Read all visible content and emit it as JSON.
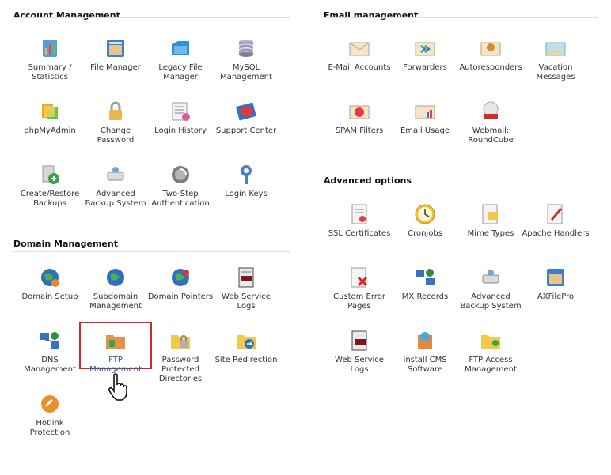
{
  "sections": {
    "account": {
      "title": "Account Management",
      "items": [
        {
          "label": "Summary / Statistics",
          "icon": "statistics-icon"
        },
        {
          "label": "File Manager",
          "icon": "file-manager-icon"
        },
        {
          "label": "Legacy File Manager",
          "icon": "legacy-file-manager-icon"
        },
        {
          "label": "MySQL Management",
          "icon": "database-icon"
        },
        {
          "label": "phpMyAdmin",
          "icon": "phpmyadmin-icon"
        },
        {
          "label": "Change Password",
          "icon": "padlock-icon"
        },
        {
          "label": "Login History",
          "icon": "login-history-icon"
        },
        {
          "label": "Support Center",
          "icon": "support-center-icon"
        },
        {
          "label": "Create/Restore Backups",
          "icon": "backup-icon"
        },
        {
          "label": "Advanced Backup System",
          "icon": "advanced-backup-icon"
        },
        {
          "label": "Two-Step Authentication",
          "icon": "two-step-auth-icon"
        },
        {
          "label": "Login Keys",
          "icon": "key-icon"
        }
      ]
    },
    "domain": {
      "title": "Domain Management",
      "items": [
        {
          "label": "Domain Setup",
          "icon": "domain-setup-icon"
        },
        {
          "label": "Subdomain Management",
          "icon": "subdomain-icon"
        },
        {
          "label": "Domain Pointers",
          "icon": "domain-pointers-icon"
        },
        {
          "label": "Web Service Logs",
          "icon": "log-file-icon"
        },
        {
          "label": "DNS Management",
          "icon": "dns-icon"
        },
        {
          "label": "FTP Management",
          "icon": "ftp-folder-icon"
        },
        {
          "label": "Password Protected Directories",
          "icon": "protected-folder-icon"
        },
        {
          "label": "Site Redirection",
          "icon": "redirect-folder-icon"
        },
        {
          "label": "Hotlink Protection",
          "icon": "hotlink-icon"
        }
      ]
    },
    "email": {
      "title": "Email management",
      "items": [
        {
          "label": "E-Mail Accounts",
          "icon": "envelope-icon"
        },
        {
          "label": "Forwarders",
          "icon": "forwarders-icon"
        },
        {
          "label": "Autoresponders",
          "icon": "autoresponder-icon"
        },
        {
          "label": "Vacation Messages",
          "icon": "vacation-icon"
        },
        {
          "label": "SPAM Filters",
          "icon": "spam-filter-icon"
        },
        {
          "label": "Email Usage",
          "icon": "email-usage-icon"
        },
        {
          "label": "Webmail: RoundCube",
          "icon": "webmail-icon"
        }
      ]
    },
    "advanced": {
      "title": "Advanced options",
      "items": [
        {
          "label": "SSL Certificates",
          "icon": "certificate-icon"
        },
        {
          "label": "Cronjobs",
          "icon": "clock-icon"
        },
        {
          "label": "Mime Types",
          "icon": "mime-types-icon"
        },
        {
          "label": "Apache Handlers",
          "icon": "apache-handlers-icon"
        },
        {
          "label": "Custom Error Pages",
          "icon": "error-page-icon"
        },
        {
          "label": "MX Records",
          "icon": "mx-records-icon"
        },
        {
          "label": "Advanced Backup System",
          "icon": "advanced-backup-icon"
        },
        {
          "label": "AXFilePro",
          "icon": "axfilepro-icon"
        },
        {
          "label": "Web Service Logs",
          "icon": "log-file-icon"
        },
        {
          "label": "Install CMS Software",
          "icon": "cms-install-icon"
        },
        {
          "label": "FTP Access Management",
          "icon": "ftp-access-icon"
        }
      ]
    }
  },
  "highlight": {
    "item": "FTP Management",
    "border_color": "#d12a2a"
  }
}
